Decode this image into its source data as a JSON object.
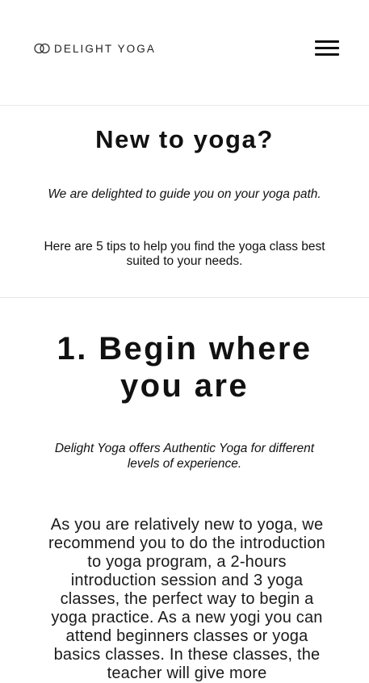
{
  "header": {
    "logo_text": "DELIGHT YOGA",
    "menu_icon": "hamburger-menu-icon"
  },
  "intro": {
    "title": "New to yoga?",
    "tagline": "We are delighted to guide you on your yoga path.",
    "tips": "Here are 5 tips to help you find the yoga class best suited to your needs."
  },
  "section1": {
    "title": "1. Begin where you are",
    "tagline": "Delight Yoga offers Authentic Yoga for different levels of experience.",
    "body": "As you are relatively new to yoga, we recommend you to do the introduction to yoga program, a 2-hours introduction session and 3 yoga classes, the perfect way to begin a yoga practice. As a new yogi you can attend beginners classes or yoga basics classes. In these classes, the teacher will give more"
  },
  "colors": {
    "text": "#111111",
    "background": "#ffffff",
    "divider": "#e8e8e8"
  }
}
